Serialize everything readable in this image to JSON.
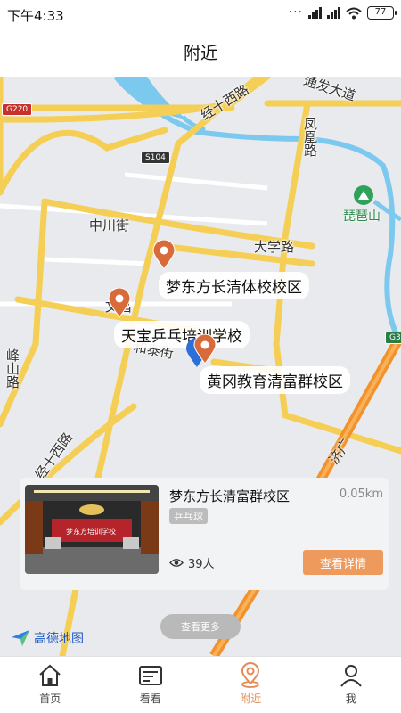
{
  "status_bar": {
    "time": "下午4:33",
    "battery": "77",
    "more_dots": "···"
  },
  "header": {
    "title": "附近"
  },
  "map": {
    "road_labels": [
      "通发大道",
      "经十西路",
      "凤凰路",
      "中川街",
      "大学路",
      "峰山路",
      "经十西路",
      "济广"
    ],
    "place_labels": [
      "文昌",
      "和泰街"
    ],
    "road_badges": [
      "G220",
      "S104",
      "G3"
    ],
    "park_label": "琵琶山",
    "pois": [
      {
        "name": "梦东方长清体校校区"
      },
      {
        "name": "天宝乒乓培训学校"
      },
      {
        "name": "黄冈教育清富群校区"
      }
    ],
    "logo_text": "高德地图",
    "colors": {
      "major_road": "#f5cf55",
      "highway": "#f3922b",
      "water": "#7cc9ef",
      "selected_pin": "#2d6fd8",
      "pin": "#d96b3a"
    }
  },
  "card": {
    "name": "梦东方长清富群校区",
    "distance": "0.05km",
    "tag": "乒乓球",
    "views": "39人",
    "detail_button": "查看详情",
    "thumb_sign": "梦东方培训学校"
  },
  "more_button": "查看更多",
  "tabs": [
    {
      "label": "首页",
      "icon": "home-icon"
    },
    {
      "label": "看看",
      "icon": "news-icon"
    },
    {
      "label": "附近",
      "icon": "location-icon",
      "active": true
    },
    {
      "label": "我",
      "icon": "person-icon"
    }
  ]
}
